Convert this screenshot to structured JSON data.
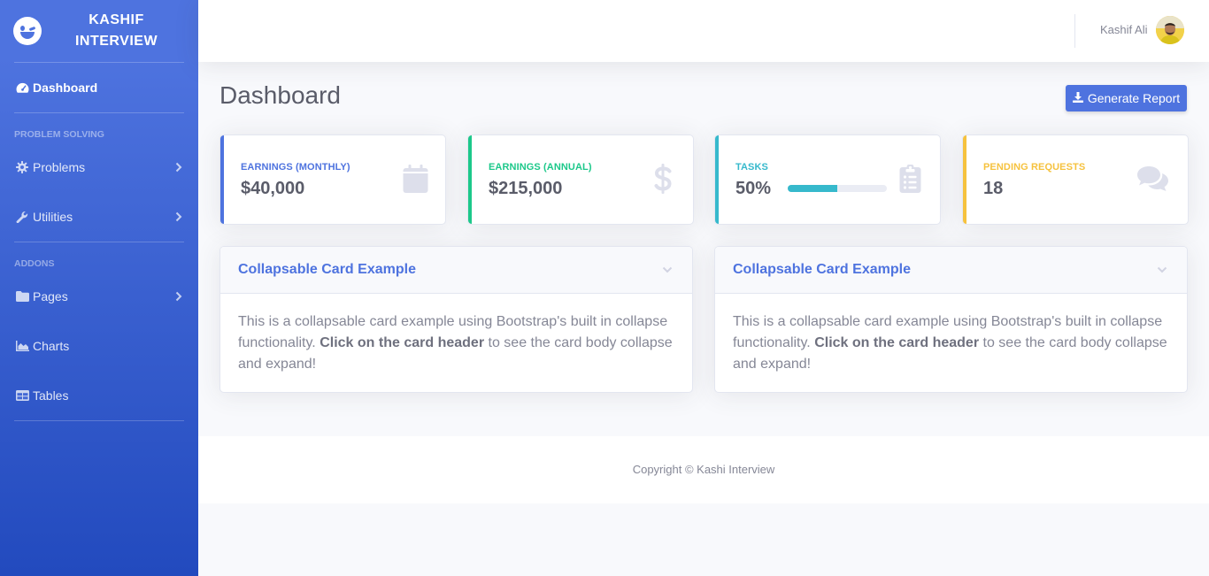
{
  "brand": {
    "line1": "KASHIF",
    "line2": "INTERVIEW",
    "logo_icon": "laugh-wink-icon"
  },
  "sidebar": {
    "dashboard": {
      "label": "Dashboard",
      "icon": "tachometer-icon"
    },
    "heading_problem_solving": "PROBLEM SOLVING",
    "problems": {
      "label": "Problems",
      "icon": "cog-icon"
    },
    "utilities": {
      "label": "Utilities",
      "icon": "wrench-icon"
    },
    "heading_addons": "ADDONS",
    "pages": {
      "label": "Pages",
      "icon": "folder-icon"
    },
    "charts": {
      "label": "Charts",
      "icon": "area-chart-icon"
    },
    "tables": {
      "label": "Tables",
      "icon": "table-icon"
    }
  },
  "topbar": {
    "user_name": "Kashif Ali"
  },
  "main": {
    "title": "Dashboard",
    "report_button": "Generate Report",
    "stats": [
      {
        "title": "EARNINGS (MONTHLY)",
        "value": "$40,000",
        "color": "#4e73df",
        "icon": "calendar-icon"
      },
      {
        "title": "EARNINGS (ANNUAL)",
        "value": "$215,000",
        "color": "#1cc88a",
        "icon": "dollar-icon"
      },
      {
        "title": "TASKS",
        "value": "50%",
        "progress": 0.5,
        "color": "#36b9cc",
        "icon": "clipboard-list-icon"
      },
      {
        "title": "PENDING REQUESTS",
        "value": "18",
        "color": "#f6c23e",
        "icon": "comments-icon"
      }
    ],
    "cards": [
      {
        "title": "Collapsable Card Example",
        "text_before": "This is a collapsable card example using Bootstrap's built in collapse functionality.",
        "text_bold": "Click on the card header",
        "text_after": "to see the card body collapse and expand!"
      },
      {
        "title": "Collapsable Card Example",
        "text_before": "This is a collapsable card example using Bootstrap's built in collapse functionality.",
        "text_bold": "Click on the card header",
        "text_after": "to see the card body collapse and expand!"
      }
    ]
  },
  "footer": {
    "text": "Copyright © Kashi Interview"
  }
}
